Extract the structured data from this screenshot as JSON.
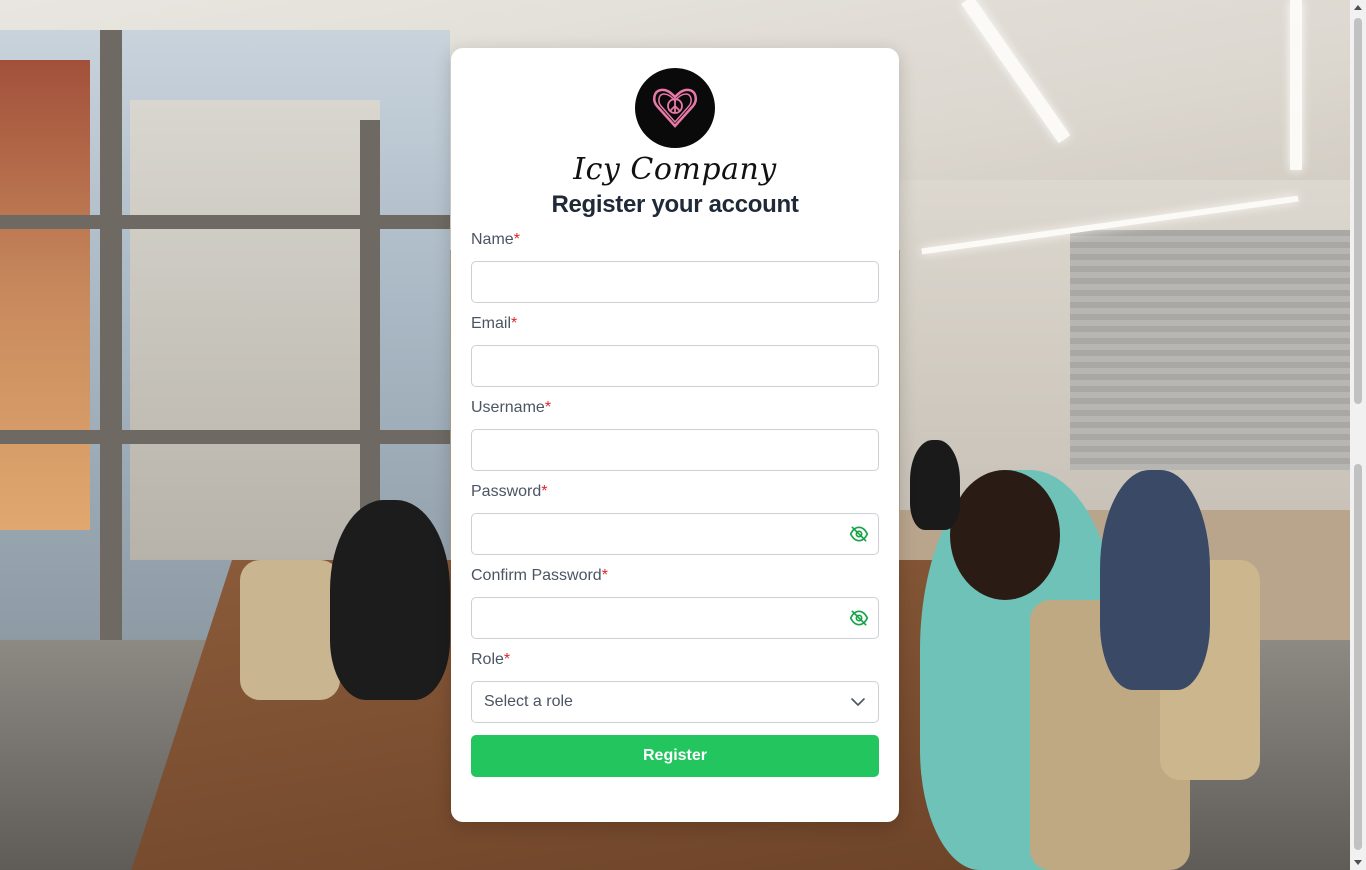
{
  "brand": {
    "name": "Icy Company",
    "logo_icon": "heart-peace-icon",
    "logo_color": "#e879a8"
  },
  "form": {
    "title": "Register your account",
    "required_mark": "*",
    "fields": {
      "name": {
        "label": "Name",
        "value": ""
      },
      "email": {
        "label": "Email",
        "value": ""
      },
      "username": {
        "label": "Username",
        "value": ""
      },
      "password": {
        "label": "Password",
        "value": "",
        "toggle_icon": "eye-off-icon"
      },
      "confirm_password": {
        "label": "Confirm Password",
        "value": "",
        "toggle_icon": "eye-off-icon"
      },
      "role": {
        "label": "Role",
        "placeholder": "Select a role",
        "icon": "chevron-down-icon"
      }
    },
    "submit_label": "Register"
  },
  "colors": {
    "accent": "#22c55e",
    "required": "#dc2626",
    "eye_icon": "#16a34a"
  }
}
